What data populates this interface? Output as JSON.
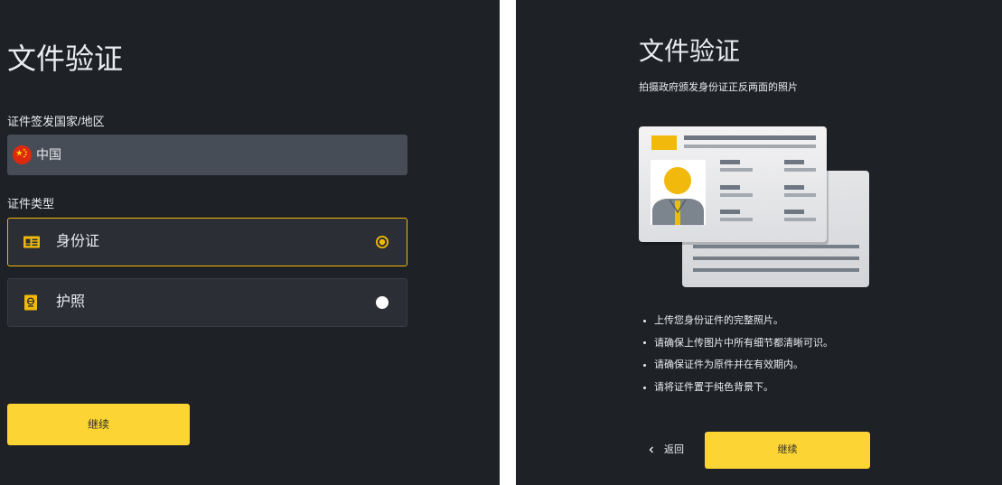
{
  "colors": {
    "accent": "#fcd535",
    "selected_border": "#f0b90b",
    "background": "#1e2126",
    "card": "#2b2e35",
    "card_border": "#383c43",
    "select_field": "#474d57",
    "text": "#eaecef",
    "button_text": "#2f2d25"
  },
  "left": {
    "title": "文件验证",
    "country_label": "证件签发国家/地区",
    "country": {
      "flag_icon": "china-flag-icon",
      "value": "中国"
    },
    "doc_type_label": "证件类型",
    "options": [
      {
        "icon": "id-card-icon",
        "label": "身份证",
        "selected": true
      },
      {
        "icon": "passport-icon",
        "label": "护照",
        "selected": false
      }
    ],
    "continue_label": "继续"
  },
  "right": {
    "title": "文件验证",
    "subtitle": "拍摄政府颁发身份证正反两面的照片",
    "illustration": "id-card-front-back-illustration",
    "tips": [
      "上传您身份证件的完整照片。",
      "请确保上传图片中所有细节都清晰可识。",
      "请确保证件为原件并在有效期内。",
      "请将证件置于纯色背景下。"
    ],
    "back": {
      "icon": "chevron-left-icon",
      "label": "返回"
    },
    "continue_label": "继续"
  }
}
